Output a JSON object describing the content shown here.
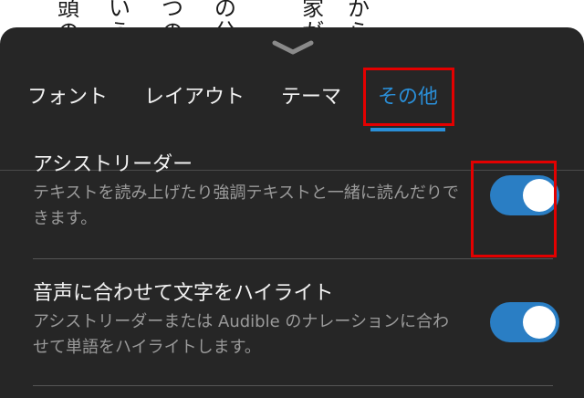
{
  "background_text": {
    "columns": [
      "頭の",
      "いう",
      "つの",
      "の分",
      "家が",
      "から"
    ]
  },
  "tabs": [
    {
      "label": "フォント",
      "active": false
    },
    {
      "label": "レイアウト",
      "active": false
    },
    {
      "label": "テーマ",
      "active": false
    },
    {
      "label": "その他",
      "active": true
    }
  ],
  "settings": {
    "assist_reader": {
      "title": "アシストリーダー",
      "description": "テキストを読み上げたり強調テキストと一緒に読んだりできます。",
      "enabled": true
    },
    "highlight": {
      "title": "音声に合わせて文字をハイライト",
      "description": "アシストリーダーまたは Audible のナレーションに合わせて単語をハイライトします。",
      "enabled": true
    }
  },
  "colors": {
    "sheet_bg": "#262626",
    "accent": "#2a8fd8",
    "toggle_on": "#2a7ec4",
    "highlight_box": "#e30000"
  }
}
